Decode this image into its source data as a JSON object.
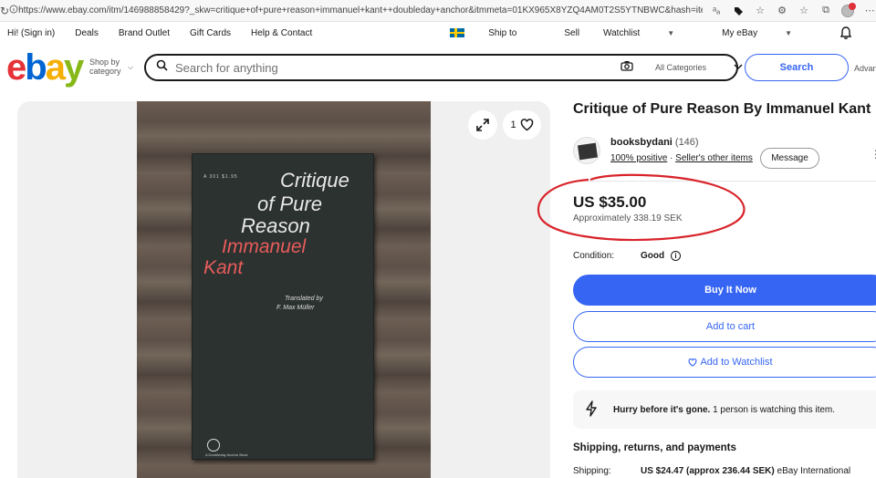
{
  "browser": {
    "url": "https://www.ebay.com/itm/146988858429?_skw=critique+of+pure+reason+immanuel+kant++doubleday+anchor&itmmeta=01KX965X8YZQ4AM0T2S5YTNBWC&hash=ite..."
  },
  "topnav": {
    "greeting": "Hi!",
    "signin": "Sign in",
    "links": [
      "Deals",
      "Brand Outlet",
      "Gift Cards",
      "Help & Contact"
    ],
    "ship_to": "Ship to",
    "sell": "Sell",
    "watchlist": "Watchlist",
    "my_ebay": "My eBay"
  },
  "header": {
    "logo": {
      "e": "e",
      "b": "b",
      "a": "a",
      "y": "y"
    },
    "shop_by_1": "Shop by",
    "shop_by_2": "category",
    "search_placeholder": "Search for anything",
    "category": "All Categories",
    "search_button": "Search",
    "advanced": "Advanced"
  },
  "gallery": {
    "watch_count": "1",
    "book": {
      "small_code": "A 301    $1.95",
      "title_1": "Critique",
      "title_2": "of Pure",
      "title_3": "Reason",
      "author_1": "Immanuel",
      "author_2": "Kant",
      "translated_1": "Translated by",
      "translated_2": "F. Max Müller",
      "publisher": "A Doubleday Anchor Book"
    }
  },
  "listing": {
    "title": "Critique of Pure Reason By Immanuel Kant",
    "seller_name": "booksbydani",
    "seller_count": "(146)",
    "seller_positive": "100% positive",
    "seller_dot": " · ",
    "seller_other": "Seller's other items",
    "message_button": "Message",
    "price": "US $35.00",
    "approx_prefix": "Approximately",
    "approx_value": "338.19 SEK",
    "condition_label": "Condition:",
    "condition_value": "Good",
    "buy_now": "Buy It Now",
    "add_to_cart": "Add to cart",
    "add_to_watchlist": "Add to Watchlist",
    "hurry_bold": "Hurry before it's gone.",
    "hurry_rest": " 1 person is watching this item.",
    "shipping_heading": "Shipping, returns, and payments",
    "shipping_label": "Shipping:",
    "shipping_value_bold": "US $24.47 (approx 236.44 SEK)",
    "shipping_value_rest": " eBay International"
  },
  "colors": {
    "ebay_red": "#e53238",
    "ebay_blue": "#0064d2",
    "ebay_yellow": "#f5af02",
    "ebay_green": "#86b817",
    "action_blue": "#3665f3",
    "annotation_red": "#d8232a"
  }
}
